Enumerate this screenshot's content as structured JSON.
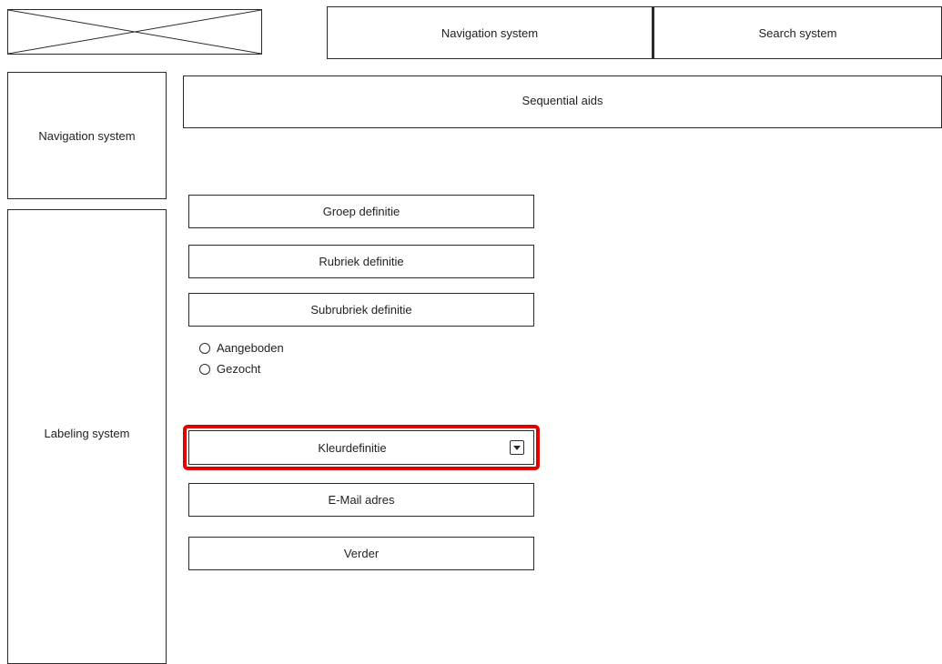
{
  "header": {
    "navigation_label": "Navigation system",
    "search_label": "Search system"
  },
  "sidebar": {
    "navigation_label": "Navigation system",
    "labeling_label": "Labeling system"
  },
  "main": {
    "sequential_aids_label": "Sequential aids",
    "fields": {
      "groep": "Groep definitie",
      "rubriek": "Rubriek definitie",
      "subrubriek": "Subrubriek definitie"
    },
    "radios": [
      {
        "label": "Aangeboden",
        "checked": false
      },
      {
        "label": "Gezocht",
        "checked": false
      }
    ],
    "color_select": {
      "selected": "Kleurdefinitie",
      "highlight_color": "#e00000"
    },
    "email_label": "E-Mail adres",
    "continue_label": "Verder"
  },
  "icons": {
    "logo": "image-placeholder-icon",
    "dropdown": "chevron-down-icon",
    "radio": "radio-unchecked-icon"
  }
}
